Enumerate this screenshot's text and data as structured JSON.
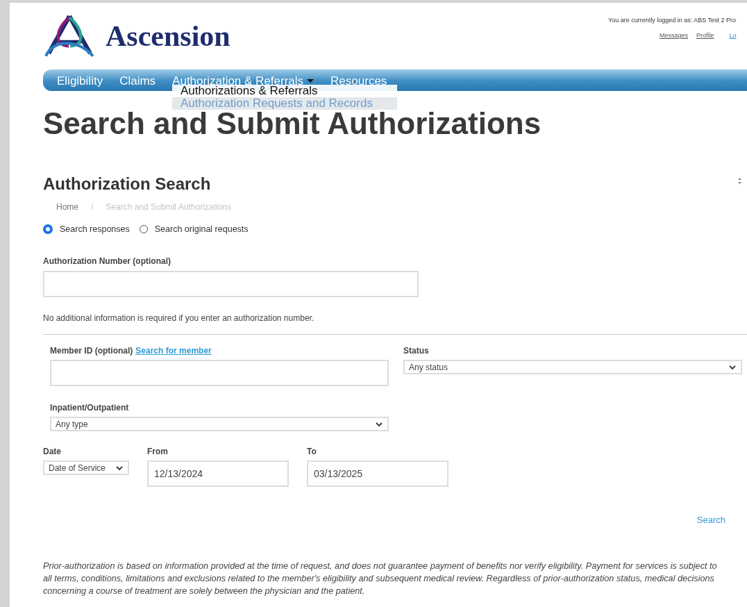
{
  "header": {
    "logo_text": "Ascension",
    "login_notice": "You are currently logged in as: ABS Test 2 Pro",
    "user_links": [
      {
        "label": "Messages"
      },
      {
        "label": "Profile"
      },
      {
        "label": "Lo"
      }
    ]
  },
  "nav": {
    "items": [
      {
        "label": "Eligibility",
        "has_menu": false
      },
      {
        "label": "Claims",
        "has_menu": false
      },
      {
        "label": "Authorization & Referrals",
        "has_menu": true
      },
      {
        "label": "Resources",
        "has_menu": false
      }
    ],
    "dropdown": [
      {
        "label": "Authorizations & Referrals",
        "highlighted": false
      },
      {
        "label": "Authorization Requests and Records",
        "highlighted": true
      }
    ]
  },
  "page_title": "Search and Submit Authorizations",
  "section_title": "Authorization Search",
  "breadcrumb": {
    "separator": "/",
    "items": [
      {
        "label": "Home",
        "current": false
      },
      {
        "label": "Search and Submit Authorizations",
        "current": true
      }
    ]
  },
  "search_mode": [
    {
      "label": "Search responses",
      "selected": true
    },
    {
      "label": "Search original requests",
      "selected": false
    }
  ],
  "authorization_number": {
    "label": "Authorization Number (optional)"
  },
  "note": "No additional information is required if you enter an authorization number.",
  "member_id": {
    "label": "Member ID (optional)",
    "link": "Search for member"
  },
  "status": {
    "label": "Status",
    "value": "Any status"
  },
  "inpatient_outpatient": {
    "label": "Inpatient/Outpatient",
    "value": "Any type"
  },
  "date": {
    "label": "Date",
    "value": "Date of Service"
  },
  "from": {
    "label": "From",
    "value": "12/13/2024"
  },
  "to": {
    "label": "To",
    "value": "03/13/2025"
  },
  "search_link": "Search",
  "disclaimer": "Prior-authorization is based on information provided at the time of request, and does not guarantee payment of benefits nor verify eligibility. Payment for services is subject to all terms, conditions, limitations and exclusions related to the member's eligibility and subsequent medical review. Regardless of prior-authorization status, medical decisions concerning a course of treatment are solely between the physician and the patient."
}
